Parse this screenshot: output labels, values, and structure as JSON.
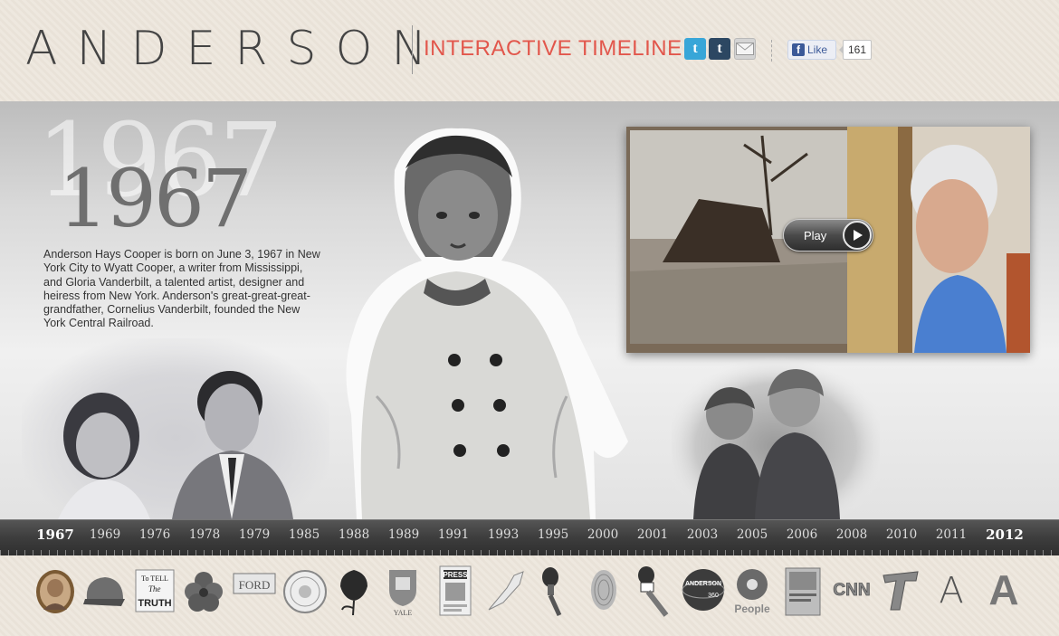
{
  "header": {
    "logo": "ANDERSON",
    "subtitle": "INTERACTIVE TIMELINE",
    "share": {
      "twitter": "t",
      "tumblr": "t"
    },
    "facebook": {
      "like_label": "Like",
      "like_count": "161"
    }
  },
  "feature": {
    "year": "1967",
    "year_ghost": "1967",
    "description": "Anderson Hays Cooper is born on June 3, 1967 in New York City to Wyatt Cooper, a writer from Mississippi, and Gloria Vanderbilt, a talented artist, designer and heiress from New York. Anderson's great-great-great-grandfather, Cornelius Vanderbilt, founded the New York Central Railroad.",
    "video": {
      "play_label": "Play"
    }
  },
  "timeline": {
    "years": [
      "1967",
      "1969",
      "1976",
      "1978",
      "1979",
      "1985",
      "1988",
      "1989",
      "1991",
      "1993",
      "1995",
      "2000",
      "2001",
      "2003",
      "2005",
      "2006",
      "2008",
      "2010",
      "2011",
      "2012"
    ],
    "active": "1967",
    "bold_last": "2012"
  },
  "icons": {
    "ford_text": "FORD",
    "tell_truth_top": "To TELL",
    "tell_truth_mid": "The",
    "tell_truth_bottom": "TRUTH",
    "press_text": "PRESS",
    "yale_text": "YALE",
    "anderson360_top": "ANDERSON",
    "anderson360_num": "360",
    "people_text": "People",
    "cnn_text": "CNN",
    "letter_a": "A"
  },
  "colors": {
    "accent": "#e2574c",
    "twitter": "#38a6d8",
    "tumblr": "#2c4762",
    "facebook": "#3b5998",
    "timeline_bar": "#3d3d3d"
  }
}
